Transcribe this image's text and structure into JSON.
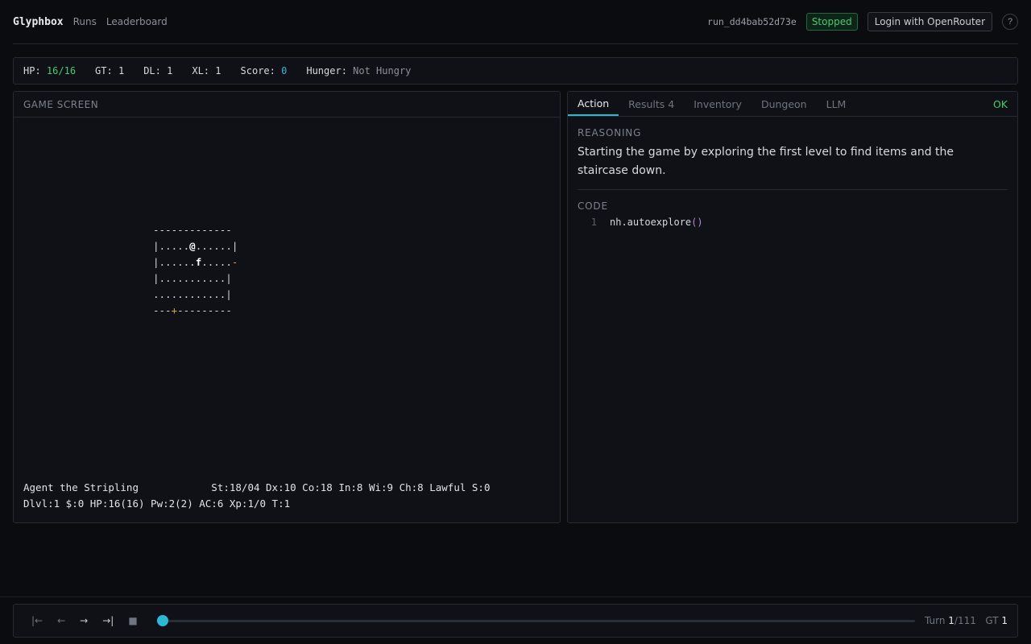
{
  "nav": {
    "brand": "Glyphbox",
    "links": [
      "Runs",
      "Leaderboard"
    ],
    "run_id": "run_dd4bab52d73e",
    "status": "Stopped",
    "login_label": "Login with OpenRouter",
    "help_label": "?"
  },
  "stats": {
    "hp_label": "HP:",
    "hp_value": "16/16",
    "gt_label": "GT:",
    "gt_value": "1",
    "dl_label": "DL:",
    "dl_value": "1",
    "xl_label": "XL:",
    "xl_value": "1",
    "score_label": "Score:",
    "score_value": "0",
    "hunger_label": "Hunger:",
    "hunger_value": "Not Hungry"
  },
  "game_screen": {
    "title": "GAME SCREEN",
    "map_rows": [
      {
        "segments": [
          {
            "t": "-------------"
          }
        ]
      },
      {
        "segments": [
          {
            "t": "|....."
          },
          {
            "t": "@",
            "c": "bold"
          },
          {
            "t": "......|"
          }
        ]
      },
      {
        "segments": [
          {
            "t": "|......"
          },
          {
            "t": "f",
            "c": "bold"
          },
          {
            "t": "....."
          },
          {
            "t": "-",
            "c": "door-yellow"
          }
        ]
      },
      {
        "segments": [
          {
            "t": "|...........|"
          }
        ]
      },
      {
        "segments": [
          {
            "t": "............|"
          }
        ]
      },
      {
        "segments": [
          {
            "t": "---"
          },
          {
            "t": "+",
            "c": "door-yellow"
          },
          {
            "t": "---------"
          }
        ]
      }
    ],
    "status_line_1": "Agent the Stripling            St:18/04 Dx:10 Co:18 In:8 Wi:9 Ch:8 Lawful S:0",
    "status_line_2": "Dlvl:1 $:0 HP:16(16) Pw:2(2) AC:6 Xp:1/0 T:1"
  },
  "right_panel": {
    "tabs": [
      "Action",
      "Results 4",
      "Inventory",
      "Dungeon",
      "LLM"
    ],
    "active_tab": 0,
    "tab_status": "OK",
    "reasoning_label": "REASONING",
    "reasoning_text": "Starting the game by exploring the first level to find items and the staircase down.",
    "code_label": "CODE",
    "code_lines": [
      {
        "no": "1",
        "text": "nh.autoexplore",
        "paren": "()"
      }
    ]
  },
  "playback": {
    "buttons": [
      "|←",
      "←",
      "→",
      "→|",
      "■"
    ],
    "turn_label": "Turn",
    "turn_current": "1",
    "turn_total": "/111",
    "gt_label": "GT",
    "gt_value": "1",
    "progress": 0.0
  }
}
